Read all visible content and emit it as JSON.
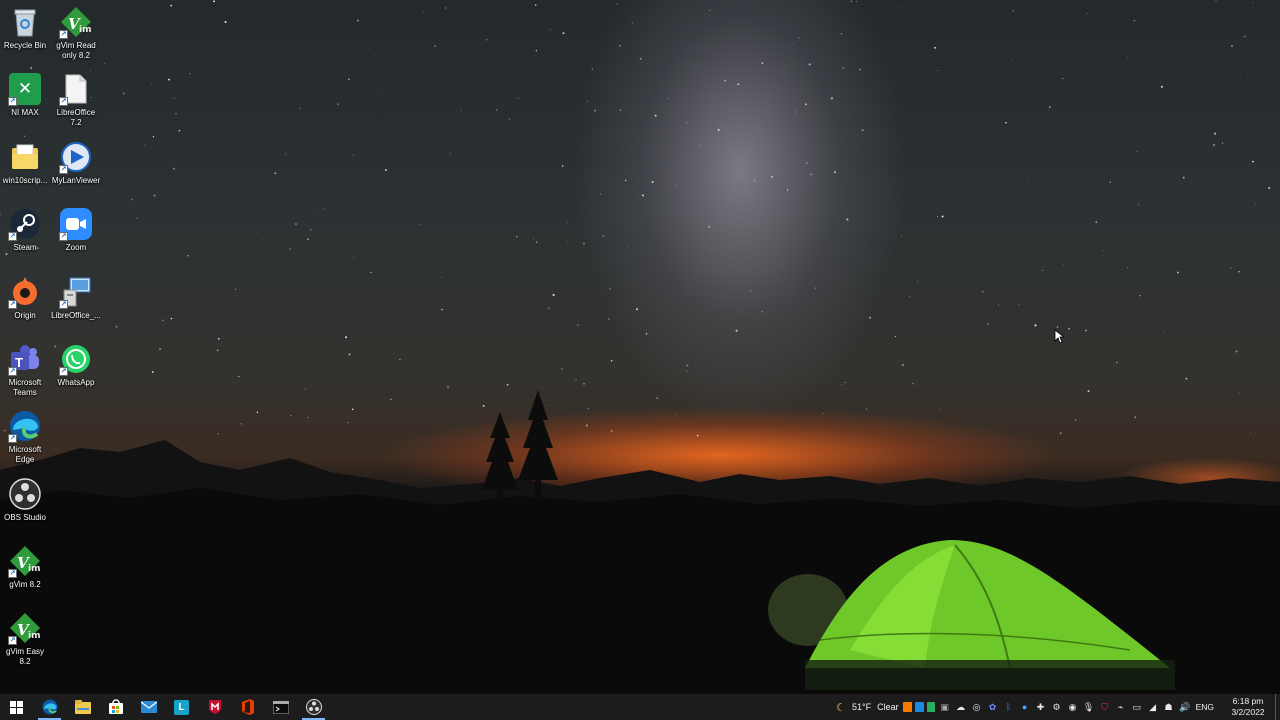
{
  "desktop": {
    "icons": [
      {
        "label": "Recycle Bin",
        "icon": "recycle-bin-icon"
      },
      {
        "label": "gVim Read only 8.2",
        "icon": "gvim-icon"
      },
      {
        "label": "NI MAX",
        "icon": "ni-max-icon"
      },
      {
        "label": "LibreOffice 7.2",
        "icon": "libreoffice-icon"
      },
      {
        "label": "win10scrip...",
        "icon": "folder-icon"
      },
      {
        "label": "MyLanViewer",
        "icon": "mylanviewer-icon"
      },
      {
        "label": "Steam",
        "icon": "steam-icon"
      },
      {
        "label": "Zoom",
        "icon": "zoom-icon"
      },
      {
        "label": "Origin",
        "icon": "origin-icon"
      },
      {
        "label": "LibreOffice_...",
        "icon": "libreoffice-installer-icon"
      },
      {
        "label": "Microsoft Teams",
        "icon": "teams-icon"
      },
      {
        "label": "WhatsApp",
        "icon": "whatsapp-icon"
      },
      {
        "label": "Microsoft Edge",
        "icon": "edge-icon"
      },
      {
        "label": "OBS Studio",
        "icon": "obs-icon"
      },
      {
        "label": "gVim 8.2",
        "icon": "gvim-icon"
      },
      {
        "label": "gVim Easy 8.2",
        "icon": "gvim-icon"
      }
    ]
  },
  "taskbar": {
    "apps": [
      "start-icon",
      "edge-icon",
      "file-explorer-icon",
      "store-icon",
      "mail-icon",
      "libreoffice-icon",
      "mcafee-icon",
      "office-icon",
      "terminal-icon",
      "obs-icon"
    ],
    "weather": {
      "temp": "51°F",
      "condition": "Clear",
      "icon": "moon-icon"
    },
    "language": "ENG",
    "clock": {
      "time": "6:18 pm",
      "date": "3/2/2022"
    }
  },
  "colors": {
    "taskbar": "#1c1c1c",
    "accent": "#7fb4ff",
    "tent": "#7cd62b"
  }
}
